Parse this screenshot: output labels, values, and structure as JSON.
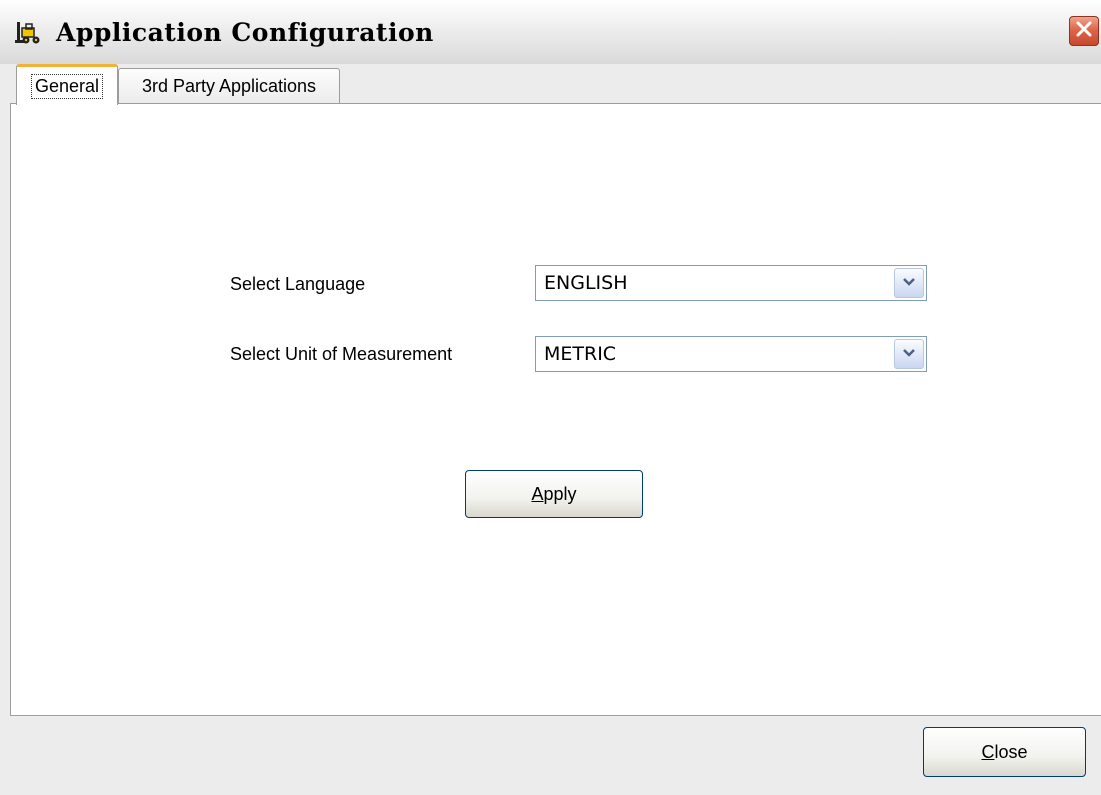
{
  "window": {
    "title": "Application Configuration",
    "icon": "forklift-app-icon"
  },
  "tabs": [
    {
      "label": "General",
      "active": true
    },
    {
      "label": "3rd Party Applications",
      "active": false
    }
  ],
  "general": {
    "language_label": "Select Language",
    "language_value": "ENGLISH",
    "unit_label": "Select Unit of Measurement",
    "unit_value": "METRIC",
    "apply_mnemonic": "A",
    "apply_rest": "pply"
  },
  "footer": {
    "close_mnemonic": "C",
    "close_rest": "lose"
  },
  "colors": {
    "active_tab_accent": "#f3b13a",
    "close_x": "#d9593b",
    "button_border": "#003c74"
  }
}
